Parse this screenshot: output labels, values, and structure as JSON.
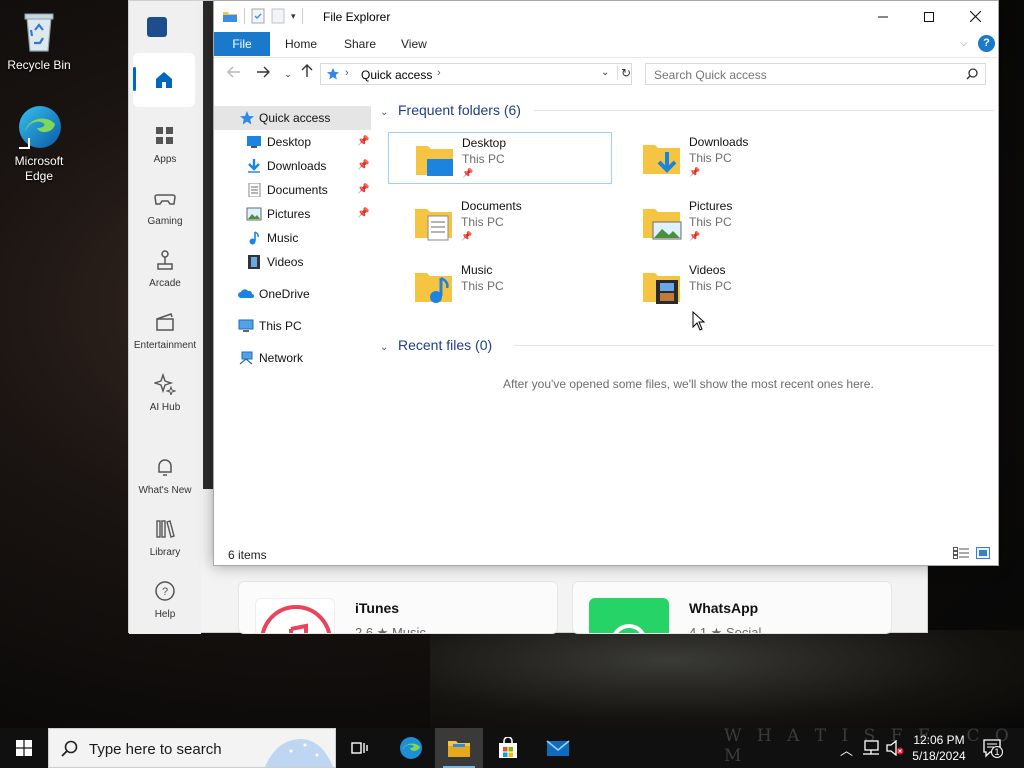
{
  "desktop": {
    "icons": [
      {
        "label": "Recycle Bin"
      },
      {
        "label": "Microsoft Edge"
      }
    ],
    "watermark": "W H A T I S F E . C O M"
  },
  "store": {
    "rail": [
      {
        "label": "Apps"
      },
      {
        "label": "Gaming"
      },
      {
        "label": "Arcade"
      },
      {
        "label": "Entertainment"
      },
      {
        "label": "AI Hub"
      },
      {
        "label": "What's New"
      },
      {
        "label": "Library"
      },
      {
        "label": "Help"
      }
    ],
    "cards": [
      {
        "name": "iTunes",
        "meta": "2.6 ★   Music"
      },
      {
        "name": "WhatsApp",
        "meta": "4.1 ★   Social"
      }
    ]
  },
  "explorer": {
    "title": "File Explorer",
    "tabs": {
      "file": "File",
      "home": "Home",
      "share": "Share",
      "view": "View"
    },
    "help": "?",
    "address": {
      "crumb": "Quick access"
    },
    "search": {
      "placeholder": "Search Quick access"
    },
    "nav": [
      {
        "label": "Quick access"
      },
      {
        "label": "Desktop"
      },
      {
        "label": "Downloads"
      },
      {
        "label": "Documents"
      },
      {
        "label": "Pictures"
      },
      {
        "label": "Music"
      },
      {
        "label": "Videos"
      },
      {
        "label": "OneDrive"
      },
      {
        "label": "This PC"
      },
      {
        "label": "Network"
      }
    ],
    "frequent": {
      "heading": "Frequent folders (6)",
      "folders": [
        {
          "name": "Desktop",
          "location": "This PC"
        },
        {
          "name": "Downloads",
          "location": "This PC"
        },
        {
          "name": "Documents",
          "location": "This PC"
        },
        {
          "name": "Pictures",
          "location": "This PC"
        },
        {
          "name": "Music",
          "location": "This PC"
        },
        {
          "name": "Videos",
          "location": "This PC"
        }
      ]
    },
    "recent": {
      "heading": "Recent files (0)",
      "empty": "After you've opened some files, we'll show the most recent ones here."
    },
    "status": {
      "count": "6 items"
    }
  },
  "taskbar": {
    "search_placeholder": "Type here to search",
    "time": "12:06 PM",
    "date": "5/18/2024",
    "notification_count": "1"
  },
  "colors": {
    "accent": "#1979ca",
    "folder": "#f5c542",
    "heading": "#1e3e8a"
  }
}
